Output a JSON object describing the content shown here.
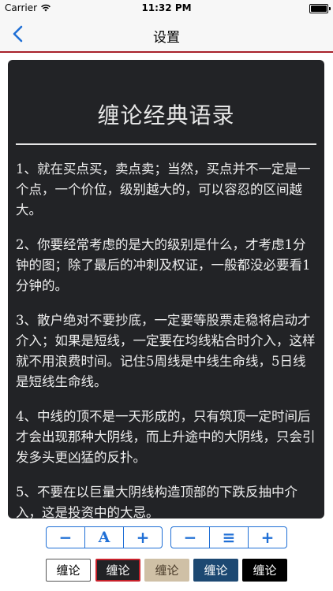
{
  "status": {
    "carrier": "Carrier",
    "time": "11:32 PM"
  },
  "nav": {
    "title": "设置"
  },
  "panel": {
    "title": "缠论经典语录",
    "paragraphs": [
      "1、就在买点买，卖点卖；当然，买点并不一定是一个点，一个价位，级别越大的，可以容忍的区间越大。",
      "2、你要经常考虑的是大的级别是什么，才考虑1分钟的图；除了最后的冲刺及权证，一般都没必要看1分钟的。",
      "3、散户绝对不要抄底，一定要等股票走稳将启动才介入；如果是短线，一定要在均线粘合时介入，这样就不用浪费时间。记住5周线是中线生命线，5日线是短线生命线。",
      "4、中线的顶不是一天形成的，只有筑顶一定时间后才会出现那种大阴线，而上升途中的大阴线，只会引发多头更凶猛的反扑。",
      "5、不要在以巨量大阴线构造顶部的下跌反抽中介入，这是投资中的大忌。"
    ]
  },
  "font_controls": {
    "decrease": "−",
    "font": "A",
    "increase": "+"
  },
  "spacing_controls": {
    "decrease": "−",
    "spacing": "≡",
    "increase": "+"
  },
  "themes": [
    {
      "label": "缠论",
      "bg": "#ffffff",
      "fg": "#000000",
      "border": "#555555"
    },
    {
      "label": "缠论",
      "bg": "#222326",
      "fg": "#ffffff",
      "border": "#c8202a"
    },
    {
      "label": "缠论",
      "bg": "#cfc0a6",
      "fg": "#4a3b2a",
      "border": "#cfc0a6"
    },
    {
      "label": "缠论",
      "bg": "#1c4872",
      "fg": "#ffffff",
      "border": "#1c4872"
    },
    {
      "label": "缠论",
      "bg": "#000000",
      "fg": "#ffffff",
      "border": "#000000"
    }
  ],
  "colors": {
    "accent": "#1f6fd6",
    "nav_divider": "#a8212a",
    "panel_bg": "#222326"
  }
}
